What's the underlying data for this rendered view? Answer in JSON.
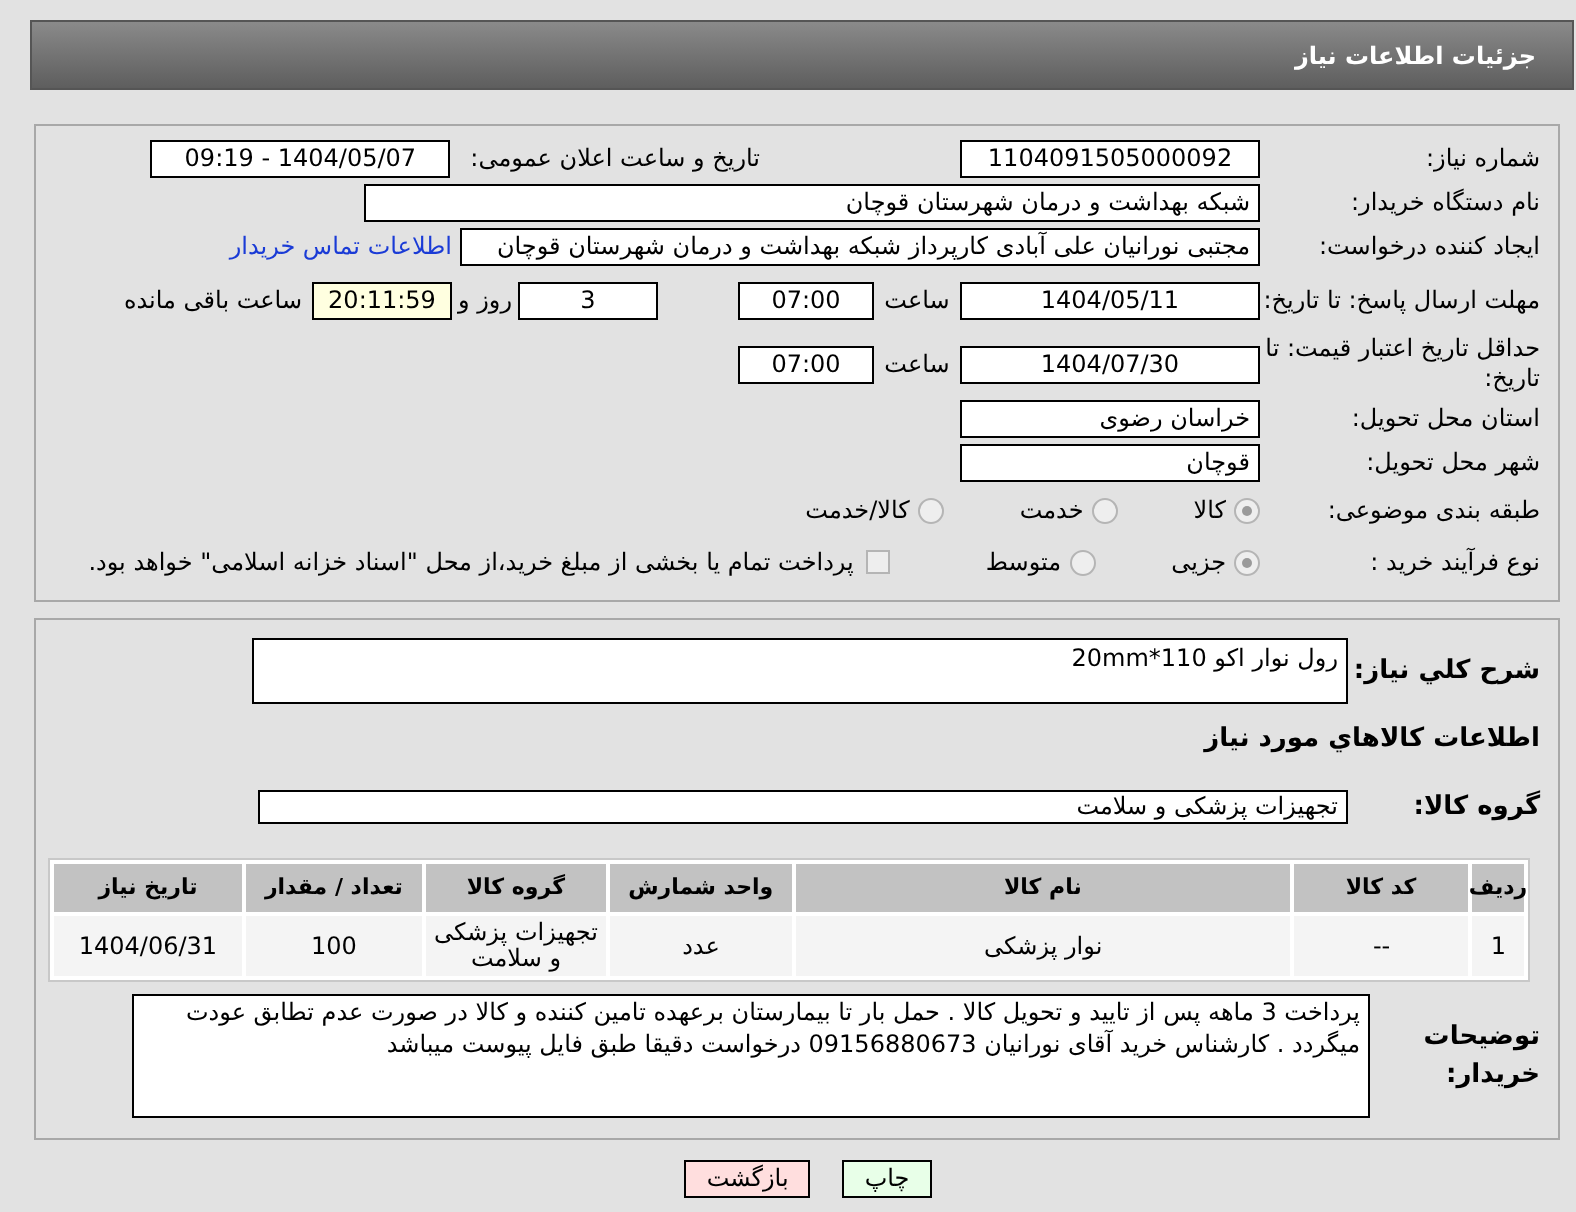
{
  "header": {
    "title": "جزئیات اطلاعات نیاز"
  },
  "fields": [
    {
      "kind": "pair",
      "label": "شماره نیاز:",
      "value": "1104091505000092",
      "label2": "تاریخ و ساعت اعلان عمومی:",
      "value2": "1404/05/07 - 09:19"
    },
    {
      "kind": "wide",
      "label": "نام دستگاه خریدار:",
      "value": "شبکه بهداشت و درمان شهرستان قوچان"
    },
    {
      "kind": "link",
      "label": "ایجاد کننده درخواست:",
      "value": "مجتبی نورانیان علی آبادی کارپرداز شبکه بهداشت و درمان شهرستان قوچان",
      "link": "اطلاعات تماس خریدار"
    },
    {
      "kind": "deadline",
      "label": "مهلت ارسال پاسخ: تا تاریخ:",
      "value": "1404/05/11",
      "time_label": "ساعت",
      "time": "07:00",
      "days": "3",
      "days_label": "روز و",
      "remaining": "20:11:59",
      "remaining_label": "ساعت باقی مانده"
    },
    {
      "kind": "deadline",
      "label": "حداقل تاریخ اعتبار قیمت: تا تاریخ:",
      "value": "1404/07/30",
      "time_label": "ساعت",
      "time": "07:00"
    },
    {
      "kind": "single",
      "label": "استان محل تحویل:",
      "value": "خراسان رضوی"
    },
    {
      "kind": "single",
      "label": "شهر محل تحویل:",
      "value": "قوچان"
    },
    {
      "kind": "radios",
      "label": "طبقه بندی موضوعی:",
      "options": [
        {
          "label": "کالا",
          "selected": true
        },
        {
          "label": "خدمت",
          "selected": false
        },
        {
          "label": "کالا/خدمت",
          "selected": false
        }
      ]
    },
    {
      "kind": "radios",
      "label": "نوع فرآیند خرید :",
      "options": [
        {
          "label": "جزیی",
          "selected": true
        },
        {
          "label": "متوسط",
          "selected": false
        }
      ],
      "checkbox": {
        "label": "پرداخت تمام یا بخشی از مبلغ خرید،از محل \"اسناد خزانه اسلامی\" خواهد بود.",
        "checked": false
      }
    }
  ],
  "summary": {
    "label": "شرح کلي نياز:",
    "value": "رول نوار اکو 110*20mm"
  },
  "goods_title": "اطلاعات کالاهاي مورد نياز",
  "group": {
    "label": "گروه کالا:",
    "value": "تجهیزات پزشکی و سلامت"
  },
  "table": {
    "columns": [
      "ردیف",
      "کد کالا",
      "نام کالا",
      "واحد شمارش",
      "گروه کالا",
      "تعداد / مقدار",
      "تاریخ نیاز"
    ],
    "rows": [
      [
        "1",
        "--",
        "نوار پزشکی",
        "عدد",
        "تجهیزات پزشکی و سلامت",
        "100",
        "1404/06/31"
      ]
    ]
  },
  "notes": {
    "label": "توضیحات خریدار:",
    "value": "پرداخت 3 ماهه  پس از تایید  و تحویل کالا . حمل بار تا بیمارستان برعهده تامین کننده و کالا در صورت عدم تطابق عودت میگردد . کارشناس خرید آقای نورانیان 09156880673  درخواست دقیقا طبق  فایل پیوست میباشد"
  },
  "buttons": [
    {
      "label": "چاپ",
      "kind": "print"
    },
    {
      "label": "بازگشت",
      "kind": "back"
    }
  ]
}
